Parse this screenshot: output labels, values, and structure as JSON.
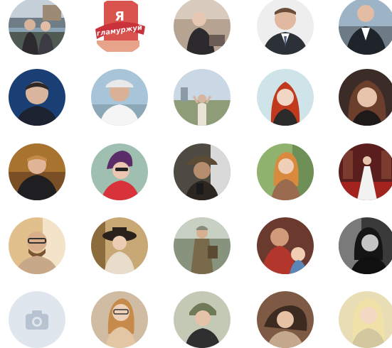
{
  "avatar_grid": {
    "avatars": [
      {
        "name": "avatar-1"
      },
      {
        "name": "avatar-2",
        "overlay_text_line1": "Я",
        "overlay_text_line2": "гламуржуй"
      },
      {
        "name": "avatar-3"
      },
      {
        "name": "avatar-4"
      },
      {
        "name": "avatar-5"
      },
      {
        "name": "avatar-6"
      },
      {
        "name": "avatar-7"
      },
      {
        "name": "avatar-8"
      },
      {
        "name": "avatar-9"
      },
      {
        "name": "avatar-10"
      },
      {
        "name": "avatar-11"
      },
      {
        "name": "avatar-12"
      },
      {
        "name": "avatar-13"
      },
      {
        "name": "avatar-14"
      },
      {
        "name": "avatar-15"
      },
      {
        "name": "avatar-16"
      },
      {
        "name": "avatar-17"
      },
      {
        "name": "avatar-18"
      },
      {
        "name": "avatar-19"
      },
      {
        "name": "avatar-20"
      },
      {
        "name": "avatar-21-placeholder",
        "icon": "camera-icon"
      },
      {
        "name": "avatar-22"
      },
      {
        "name": "avatar-23"
      },
      {
        "name": "avatar-24"
      },
      {
        "name": "avatar-25"
      }
    ]
  },
  "colors": {
    "background": "#ffffff",
    "placeholder_bg": "#dfe6ee",
    "placeholder_icon": "#b7c3d1"
  }
}
